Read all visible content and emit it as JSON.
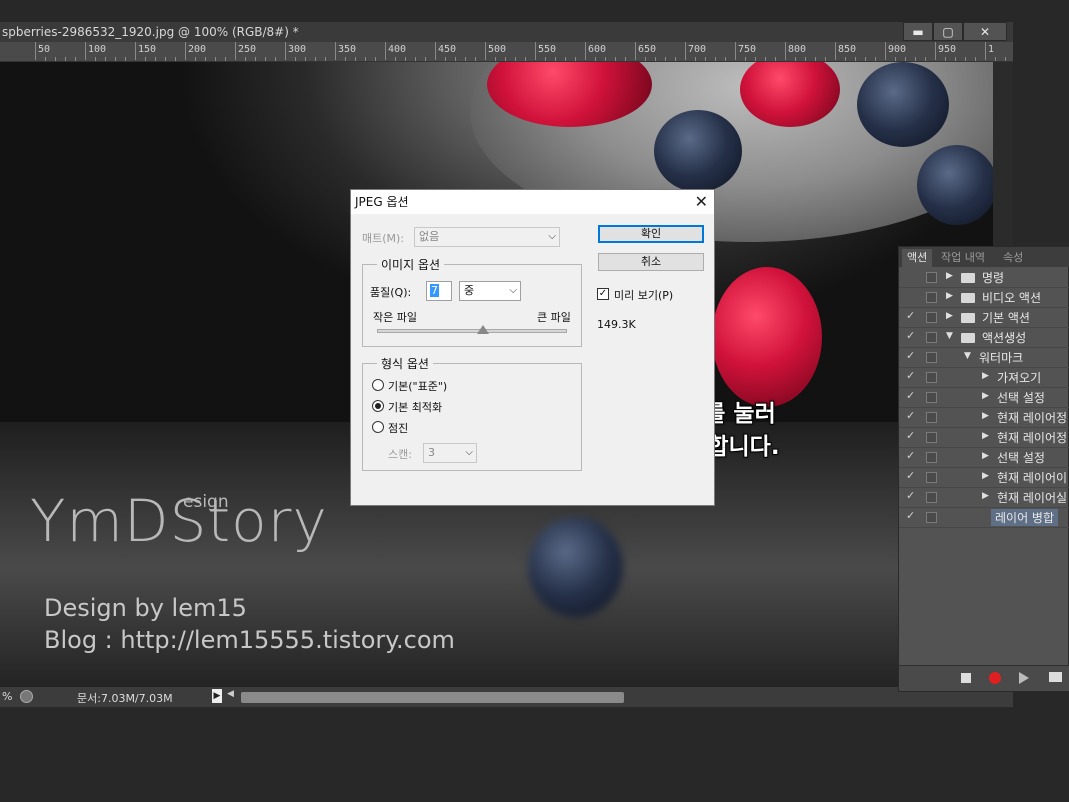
{
  "document": {
    "title": "spberries-2986532_1920.jpg @ 100% (RGB/8#) *",
    "window_buttons": {
      "minimize": "▬",
      "maximize": "▢",
      "close": "✕"
    },
    "ruler_ticks": [
      "50",
      "100",
      "150",
      "200",
      "250",
      "300",
      "350",
      "400",
      "450",
      "500",
      "550",
      "600",
      "650",
      "700",
      "750",
      "800",
      "850",
      "900",
      "950",
      "1"
    ],
    "status": {
      "zoom": "%",
      "doc_size": "문서:7.03M/7.03M"
    }
  },
  "watermark": {
    "logo": "YmDStory",
    "design": "esign",
    "by": "Design by lem15",
    "blog": "Blog : http://lem15555.tistory.com"
  },
  "overlay": {
    "line1": "[ Ctrl + S ]를 눌러",
    "line2": "이미지 저장을 합니다."
  },
  "jpeg_dialog": {
    "title": "JPEG 옵션",
    "matte_label": "매트(M):",
    "matte_value": "없음",
    "image_options_legend": "이미지 옵션",
    "quality_label": "품질(Q):",
    "quality_value": "7",
    "quality_preset": "중",
    "small_file": "작은 파일",
    "large_file": "큰 파일",
    "format_options_legend": "형식 옵션",
    "format_baseline": "기본(\"표준\")",
    "format_optimized": "기본 최적화",
    "format_progressive": "점진",
    "scans_label": "스캔:",
    "scans_value": "3",
    "ok_button": "확인",
    "cancel_button": "취소",
    "preview_label": "미리 보기(P)",
    "file_size": "149.3K",
    "quality_slider_fraction": 0.55
  },
  "actions_panel": {
    "tabs": [
      "액션",
      "작업 내역",
      "속성"
    ],
    "rows": [
      {
        "label": "명령",
        "checked": false,
        "indent": 0,
        "kind": "folder",
        "open": false
      },
      {
        "label": "비디오 액션",
        "checked": false,
        "indent": 0,
        "kind": "folder",
        "open": false
      },
      {
        "label": "기본 액션",
        "checked": true,
        "indent": 0,
        "kind": "folder",
        "open": false
      },
      {
        "label": "액션생성",
        "checked": true,
        "indent": 0,
        "kind": "folder",
        "open": true
      },
      {
        "label": "워터마크",
        "checked": true,
        "indent": 1,
        "kind": "action",
        "open": true
      },
      {
        "label": "가져오기",
        "checked": true,
        "indent": 2,
        "kind": "step",
        "open": false
      },
      {
        "label": "선택 설정",
        "checked": true,
        "indent": 2,
        "kind": "step",
        "open": false
      },
      {
        "label": "현재 레이어정",
        "checked": true,
        "indent": 2,
        "kind": "step",
        "open": false
      },
      {
        "label": "현재 레이어정",
        "checked": true,
        "indent": 2,
        "kind": "step",
        "open": false
      },
      {
        "label": "선택 설정",
        "checked": true,
        "indent": 2,
        "kind": "step",
        "open": false
      },
      {
        "label": "현재 레이어이",
        "checked": true,
        "indent": 2,
        "kind": "step",
        "open": false
      },
      {
        "label": "현재 레이어실",
        "checked": true,
        "indent": 2,
        "kind": "step",
        "open": false
      },
      {
        "label": "레이어 병합",
        "checked": true,
        "indent": 2,
        "kind": "leaf",
        "open": false
      }
    ]
  }
}
